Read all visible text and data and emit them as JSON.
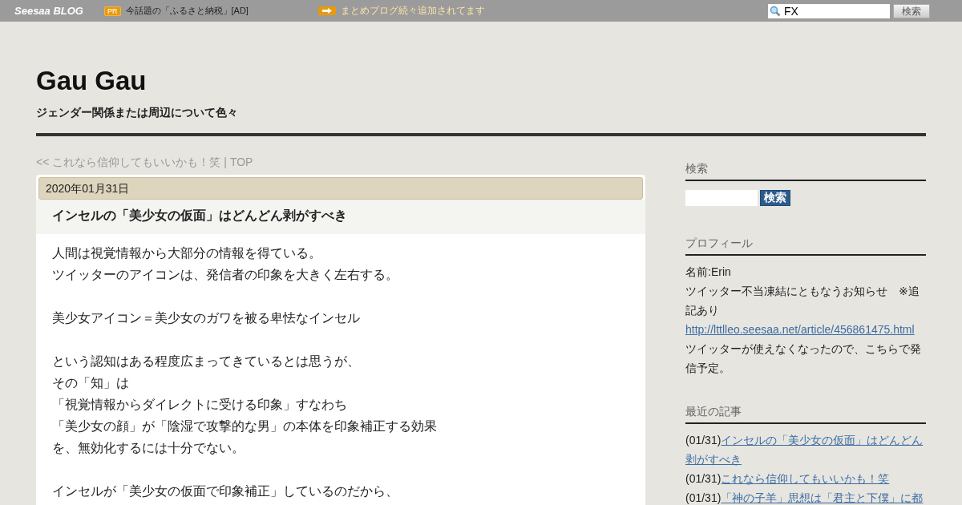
{
  "topbar": {
    "logo": "Seesaa BLOG",
    "pr_badge": "PR",
    "pr_text": "今話題の「ふるさと納税」[AD]",
    "notice": "まとめブログ続々追加されてます",
    "search_value": "FX",
    "search_button": "検索"
  },
  "blog": {
    "title": "Gau Gau",
    "subtitle": "ジェンダー関係または周辺について色々"
  },
  "nav": {
    "prev": "<< これなら信仰してもいいかも！笑",
    "separator": "|",
    "top": "TOP"
  },
  "article": {
    "date": "2020年01月31日",
    "title": "インセルの「美少女の仮面」はどんどん剥がすべき",
    "paragraphs": [
      [
        "人間は視覚情報から大部分の情報を得ている。",
        "ツイッターのアイコンは、発信者の印象を大きく左右する。"
      ],
      [
        "美少女アイコン＝美少女のガワを被る卑怯なインセル"
      ],
      [
        "という認知はある程度広まってきているとは思うが、",
        "その「知」は",
        "「視覚情報からダイレクトに受ける印象」すなわち",
        "「美少女の顔」が「陰湿で攻撃的な男」の本体を印象補正する効果",
        "を、無効化するには十分でない。"
      ],
      [
        "インセルが「美少女の仮面で印象補正」しているのだから、"
      ]
    ]
  },
  "sidebar": {
    "search": {
      "heading": "検索",
      "button": "検索"
    },
    "profile": {
      "heading": "プロフィール",
      "name": "名前:Erin",
      "notice": "ツイッター不当凍結にともなうお知らせ　※追記あり",
      "link": "http://lttlleo.seesaa.net/article/456861475.html",
      "note": "ツイッターが使えなくなったので、こちらで発信予定。"
    },
    "recent": {
      "heading": "最近の記事",
      "items": [
        {
          "date": "(01/31)",
          "title": "インセルの「美少女の仮面」はどんどん剥がすべき"
        },
        {
          "date": "(01/31)",
          "title": "これなら信仰してもいいかも！笑"
        },
        {
          "date": "(01/31)",
          "title": "「神の子羊」思想は「君主と下僕」に都"
        }
      ]
    }
  }
}
